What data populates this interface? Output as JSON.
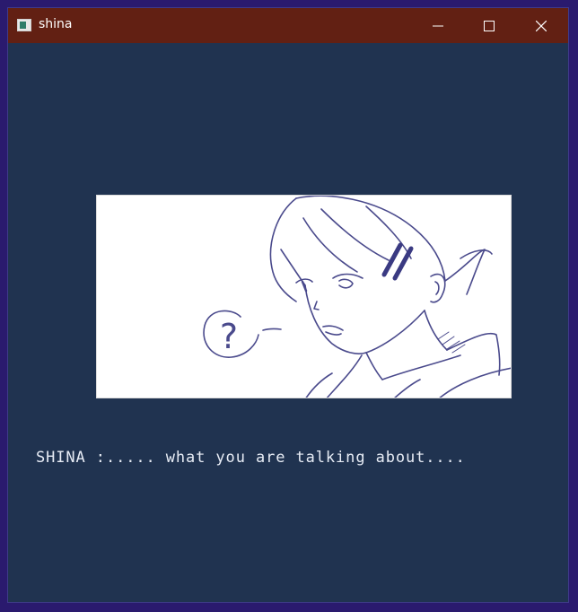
{
  "window": {
    "title": "shina",
    "icon": "app-window-icon",
    "controls": [
      "minimize-icon",
      "maximize-icon",
      "close-icon"
    ]
  },
  "colors": {
    "titlebar": "#622013",
    "background": "#203350",
    "dialogue_text": "#e7ecf5",
    "sketch_line": "#4a4a8c"
  },
  "scene": {
    "speech_bubble_text": "?"
  },
  "dialogue": {
    "text": "SHINA :..... what you are talking about...."
  }
}
